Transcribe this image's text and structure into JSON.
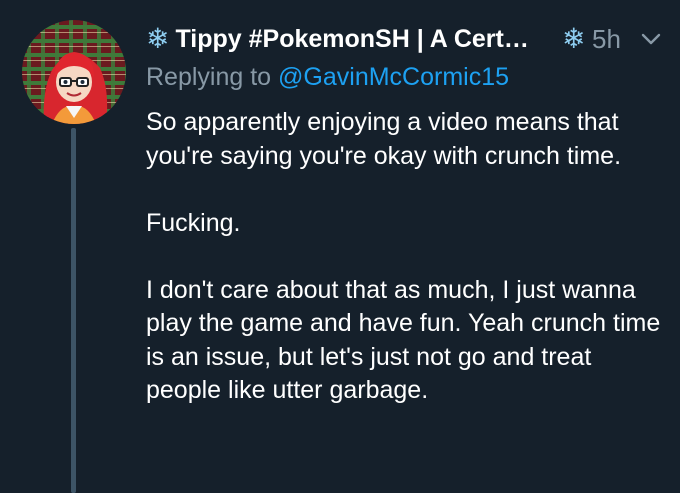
{
  "tweet": {
    "display_name": "Tippy #PokemonSH | A Cert…",
    "name_prefix_emoji": "❄",
    "name_suffix_emoji": "❄",
    "timestamp": "5h",
    "replying_prefix": "Replying to ",
    "replying_to": "@GavinMcCormic15",
    "paragraphs": [
      "So apparently enjoying a video means that you're saying you're okay with crunch time.",
      "Fucking.",
      "I don't care about that as much, I just wanna play the game and have fun. Yeah crunch time is an issue, but let's just not go and treat people like utter garbage."
    ]
  },
  "icons": {
    "avatar": "cartoon-avatar-red-hair-glasses",
    "menu": "chevron-down-icon",
    "name_emoji": "snowflake-icon"
  },
  "colors": {
    "background": "#15202b",
    "text": "#ffffff",
    "secondary": "#8899a6",
    "link": "#1da1f2",
    "thread_line": "#3d5466"
  }
}
